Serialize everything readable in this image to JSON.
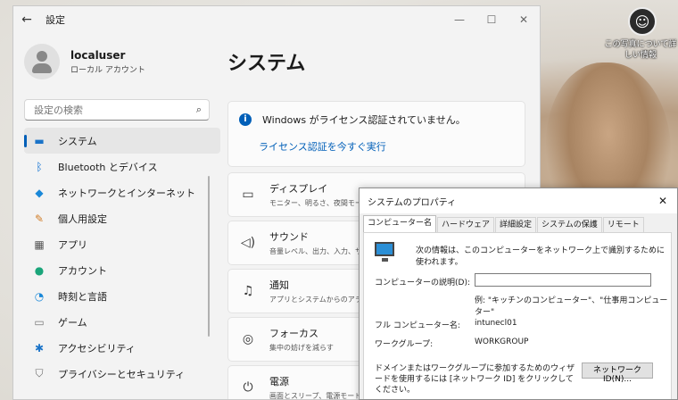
{
  "desktop": {
    "caption": "この写真について詳しい情報"
  },
  "settings": {
    "title": "設定",
    "user": {
      "name": "localuser",
      "type": "ローカル アカウント"
    },
    "search": {
      "placeholder": "設定の検索"
    },
    "nav": [
      {
        "label": "システム",
        "icon": "monitor-icon",
        "color": "#1a73c8"
      },
      {
        "label": "Bluetooth とデバイス",
        "icon": "bluetooth-icon",
        "color": "#0a6ed1"
      },
      {
        "label": "ネットワークとインターネット",
        "icon": "wifi-icon",
        "color": "#1a88d8"
      },
      {
        "label": "個人用設定",
        "icon": "brush-icon",
        "color": "#d07b24"
      },
      {
        "label": "アプリ",
        "icon": "apps-icon",
        "color": "#555555"
      },
      {
        "label": "アカウント",
        "icon": "person-icon",
        "color": "#1aa57a"
      },
      {
        "label": "時刻と言語",
        "icon": "clock-globe-icon",
        "color": "#1a88d8"
      },
      {
        "label": "ゲーム",
        "icon": "gamepad-icon",
        "color": "#7a7a7a"
      },
      {
        "label": "アクセシビリティ",
        "icon": "accessibility-icon",
        "color": "#1a73c8"
      },
      {
        "label": "プライバシーとセキュリティ",
        "icon": "shield-icon",
        "color": "#6b6b6b"
      }
    ],
    "main": {
      "title": "システム",
      "notice": {
        "message": "Windows がライセンス認証されていません。",
        "link": "ライセンス認証を今すぐ実行"
      },
      "cards": [
        {
          "title": "ディスプレイ",
          "subtitle": "モニター、明るさ、夜間モード、ディスプレイ プロファイル",
          "icon": "display-icon"
        },
        {
          "title": "サウンド",
          "subtitle": "音量レベル、出力、入力、サウンド デバイス",
          "icon": "speaker-icon"
        },
        {
          "title": "通知",
          "subtitle": "アプリとシステムからのアラート",
          "icon": "bell-icon"
        },
        {
          "title": "フォーカス",
          "subtitle": "集中の妨げを減らす",
          "icon": "focus-icon"
        },
        {
          "title": "電源",
          "subtitle": "画面とスリープ、電源モード",
          "icon": "power-icon"
        }
      ]
    }
  },
  "dialog": {
    "title": "システムのプロパティ",
    "tabs": [
      "コンピューター名",
      "ハードウェア",
      "詳細設定",
      "システムの保護",
      "リモート"
    ],
    "description": "次の情報は、このコンピューターをネットワーク上で識別するために使われます。",
    "desc_label": "コンピューターの説明(D):",
    "desc_value": "",
    "example": "例: \"キッチンのコンピューター\"、\"仕事用コンピューター\"",
    "full_name_label": "フル コンピューター名:",
    "full_name_value": "intunecl01",
    "workgroup_label": "ワークグループ:",
    "workgroup_value": "WORKGROUP",
    "wizard_text": "ドメインまたはワークグループに参加するためのウィザードを使用するには [ネットワーク ID] をクリックしてください。",
    "network_id_button": "ネットワーク ID(N)..."
  }
}
